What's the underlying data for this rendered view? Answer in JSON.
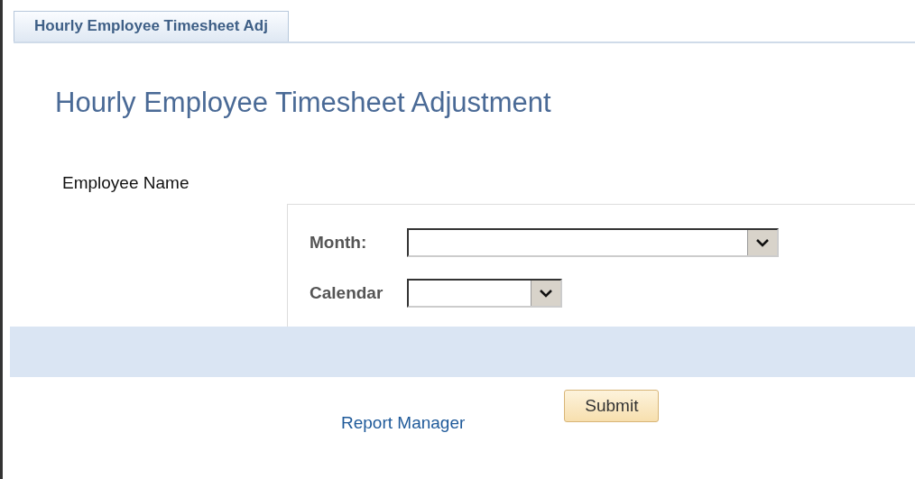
{
  "tabs": [
    {
      "label": "Hourly Employee Timesheet Adj",
      "selected": true
    }
  ],
  "page_title": "Hourly Employee Timesheet Adjustment",
  "employee_label": "Employee Name",
  "form": {
    "fields": [
      {
        "label": "Month:"
      },
      {
        "label": "Calendar"
      }
    ]
  },
  "submit_button": "Submit",
  "report_link": "Report Manager"
}
